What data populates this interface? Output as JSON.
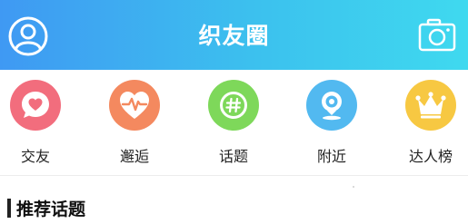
{
  "header": {
    "title": "织友圈",
    "background_colors": [
      "#3f99f3",
      "#3fd9ef"
    ],
    "left_icon": "user-avatar-icon",
    "right_icon": "camera-icon"
  },
  "categories": [
    {
      "label": "交友",
      "icon": "heart-chat-icon",
      "color": "#f26d7d"
    },
    {
      "label": "邂逅",
      "icon": "heartbeat-icon",
      "color": "#f4895f"
    },
    {
      "label": "话题",
      "icon": "hashtag-icon",
      "color": "#7ed85a"
    },
    {
      "label": "附近",
      "icon": "location-webcam-icon",
      "color": "#52b9f0"
    },
    {
      "label": "达人榜",
      "icon": "crown-icon",
      "color": "#f7c842"
    }
  ],
  "section": {
    "title": "推荐话题"
  }
}
